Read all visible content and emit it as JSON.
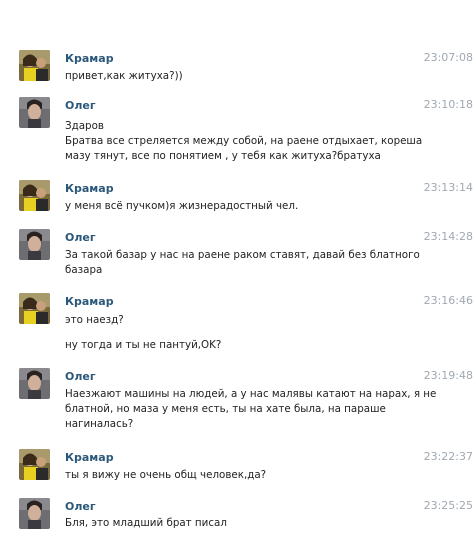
{
  "messages": [
    {
      "author": "Крамар",
      "time": "23:07:08",
      "lines": [
        "привет,как житуха?))"
      ]
    },
    {
      "author": "Олег",
      "time": "23:10:18",
      "lines": [
        "Здаров",
        "Братва все стреляется между собой, на раене отдыхает, кореша",
        "мазу тянут, все по понятием , у тебя как житуха?братуха"
      ]
    },
    {
      "author": "Крамар",
      "time": "23:13:14",
      "lines": [
        "у меня всё пучком)я жизнерадостный чел."
      ]
    },
    {
      "author": "Олег",
      "time": "23:14:28",
      "lines": [
        "За такой базар у нас на раене раком ставят, давай без блатного",
        "базара"
      ]
    },
    {
      "author": "Крамар",
      "time": "23:16:46",
      "lines": [
        "это наезд?",
        "ну тогда и ты не пантуй,OK?"
      ]
    },
    {
      "author": "Олег",
      "time": "23:19:48",
      "lines": [
        "Наезжают машины на людей, а у нас малявы катают на нарах, я не",
        "блатной, но маза у меня есть, ты на хате была, на параше",
        "нагиналась?"
      ]
    },
    {
      "author": "Крамар",
      "time": "23:22:37",
      "lines": [
        "ты я вижу не очень общ человек,да?"
      ]
    },
    {
      "author": "Олег",
      "time": "23:25:25",
      "lines": [
        "Бля, это младший брат писал"
      ]
    }
  ]
}
